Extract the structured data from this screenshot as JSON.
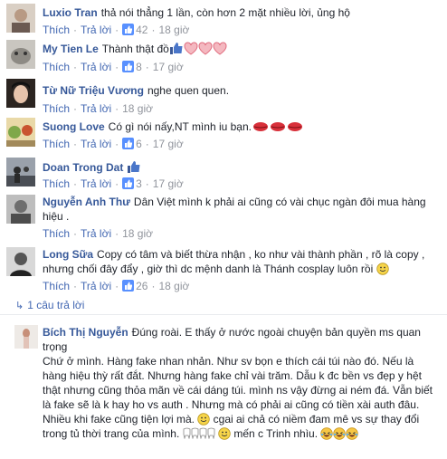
{
  "ui": {
    "like_label": "Thích",
    "reply_label": "Trả lời",
    "dot": "·"
  },
  "comments": [
    {
      "name": "Luxio Tran",
      "text": "thả nói thẳng 1 lần, còn hơn 2 mặt nhiều lời, ủng hộ",
      "likes": "42",
      "time": "18 giờ"
    },
    {
      "name": "My Tien Le",
      "text": "Thành thật đồ",
      "likes": "8",
      "time": "17 giờ"
    },
    {
      "name": "Từ Nữ Triệu Vương",
      "text": "nghe quen quen.",
      "time": "18 giờ"
    },
    {
      "name": "Suong Love",
      "text": "Có gì nói nấy,NT mình iu bạn.",
      "likes": "6",
      "time": "17 giờ"
    },
    {
      "name": "Doan Trong Dat",
      "text": "",
      "likes": "3",
      "time": "17 giờ"
    },
    {
      "name": "Nguyễn Anh Thư",
      "text": "Dân Việt mình k phải ai cũng có vài chục ngàn đôi mua hàng hiệu .",
      "time": "18 giờ"
    },
    {
      "name": "Long Sữa",
      "text": "Copy có tâm và biết thừa nhận , ko như vài thành phần , rõ là copy , nhưng chối đây đẩy , giờ thì dc mệnh danh là Thánh cosplay luôn rồi",
      "likes": "26",
      "time": "18 giờ"
    }
  ],
  "replies_link": "1 câu trả lời",
  "reply": {
    "name": "Bích Thị Nguyễn",
    "line1": "Đúng roài. E thấy ở nước ngoài chuyện bản quyền ms quan trọng",
    "line2": "Chứ ở mình. Hàng fake nhan nhản. Như sv bọn e thích cái túi nào đó. Nếu là hàng hiệu thỳ rất đắt. Nhưng hàng fake chỉ vài trăm. Dẫu k đc bền vs đẹp y hệt thật nhưng cũng thỏa mãn về cái dáng túi. mình ns vậy đừng ai ném đá. Vẫn biết là fake sẽ là k hay ho vs auth . Nhưng mà có phải ai cũng có tiền xài auth đâu. Nhiều khi fake cũng tiện lợi mà.",
    "line3": "cgai ai chả có niềm đam mê vs sự thay đổi trong tủ thời trang của mình.",
    "line4": "mến c Trinh nhìu."
  },
  "colors": {
    "name": "#365899",
    "link": "#4267b2",
    "meta": "#90949c",
    "like_blue": "#5890ff",
    "heart_pink": "#f4a6b0"
  }
}
